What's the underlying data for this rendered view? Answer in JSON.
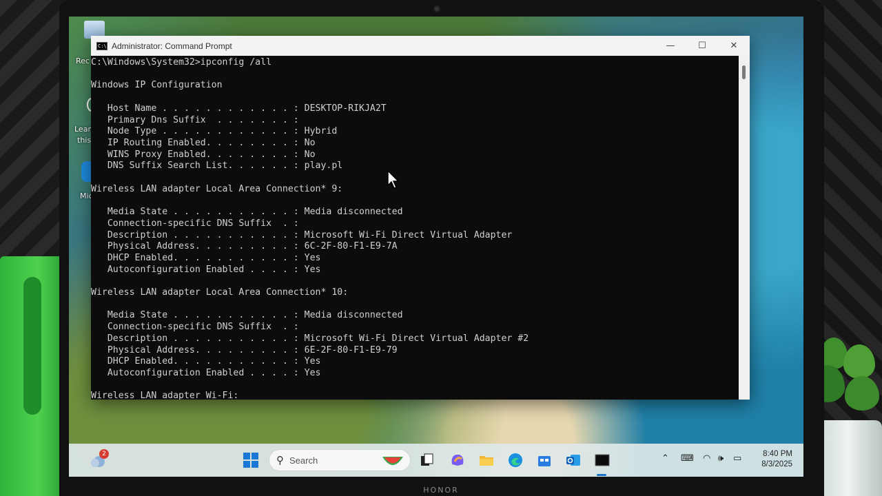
{
  "window": {
    "title": "Administrator: Command Prompt",
    "icon_text": "C:\\",
    "minimize_glyph": "—",
    "maximize_glyph": "☐",
    "close_glyph": "✕"
  },
  "console_lines": [
    "C:\\Windows\\System32>ipconfig /all",
    "",
    "Windows IP Configuration",
    "",
    "   Host Name . . . . . . . . . . . . : DESKTOP-RIKJA2T",
    "   Primary Dns Suffix  . . . . . . . :",
    "   Node Type . . . . . . . . . . . . : Hybrid",
    "   IP Routing Enabled. . . . . . . . : No",
    "   WINS Proxy Enabled. . . . . . . . : No",
    "   DNS Suffix Search List. . . . . . : play.pl",
    "",
    "Wireless LAN adapter Local Area Connection* 9:",
    "",
    "   Media State . . . . . . . . . . . : Media disconnected",
    "   Connection-specific DNS Suffix  . :",
    "   Description . . . . . . . . . . . : Microsoft Wi-Fi Direct Virtual Adapter",
    "   Physical Address. . . . . . . . . : 6C-2F-80-F1-E9-7A",
    "   DHCP Enabled. . . . . . . . . . . : Yes",
    "   Autoconfiguration Enabled . . . . : Yes",
    "",
    "Wireless LAN adapter Local Area Connection* 10:",
    "",
    "   Media State . . . . . . . . . . . : Media disconnected",
    "   Connection-specific DNS Suffix  . :",
    "   Description . . . . . . . . . . . : Microsoft Wi-Fi Direct Virtual Adapter #2",
    "   Physical Address. . . . . . . . . : 6E-2F-80-F1-E9-79",
    "   DHCP Enabled. . . . . . . . . . . : Yes",
    "   Autoconfiguration Enabled . . . . : Yes",
    "",
    "Wireless LAN adapter Wi-Fi:"
  ],
  "desktop": {
    "icon_labels": [
      "Rec",
      "Learn",
      "this",
      "Mic"
    ]
  },
  "taskbar": {
    "weather_badge": "2",
    "search_placeholder": "Search",
    "search_glyph": "⚲",
    "clock_time": "8:40 PM",
    "clock_date": "8/3/2025",
    "tray_icons": [
      "chevron-up-icon",
      "keyboard-icon",
      "wifi-icon",
      "speaker-icon",
      "battery-icon"
    ],
    "tray_glyphs": {
      "chevron": "⌃",
      "keyboard": "⌨",
      "wifi": "◠",
      "speaker": "🕪",
      "battery": "▭"
    },
    "pinned_icons": [
      "windows-start-icon",
      "search-icon",
      "task-view-icon",
      "copilot-icon",
      "file-explorer-icon",
      "edge-icon",
      "store-icon",
      "outlook-icon",
      "terminal-icon"
    ]
  },
  "device": {
    "brand": "HONOR"
  },
  "colors": {
    "console_bg": "#0c0c0c",
    "console_fg": "#d0d0d0",
    "titlebar_bg": "#f3f3f3",
    "taskbar_bg": "#dee8e8",
    "accent": "#1a73c9"
  }
}
